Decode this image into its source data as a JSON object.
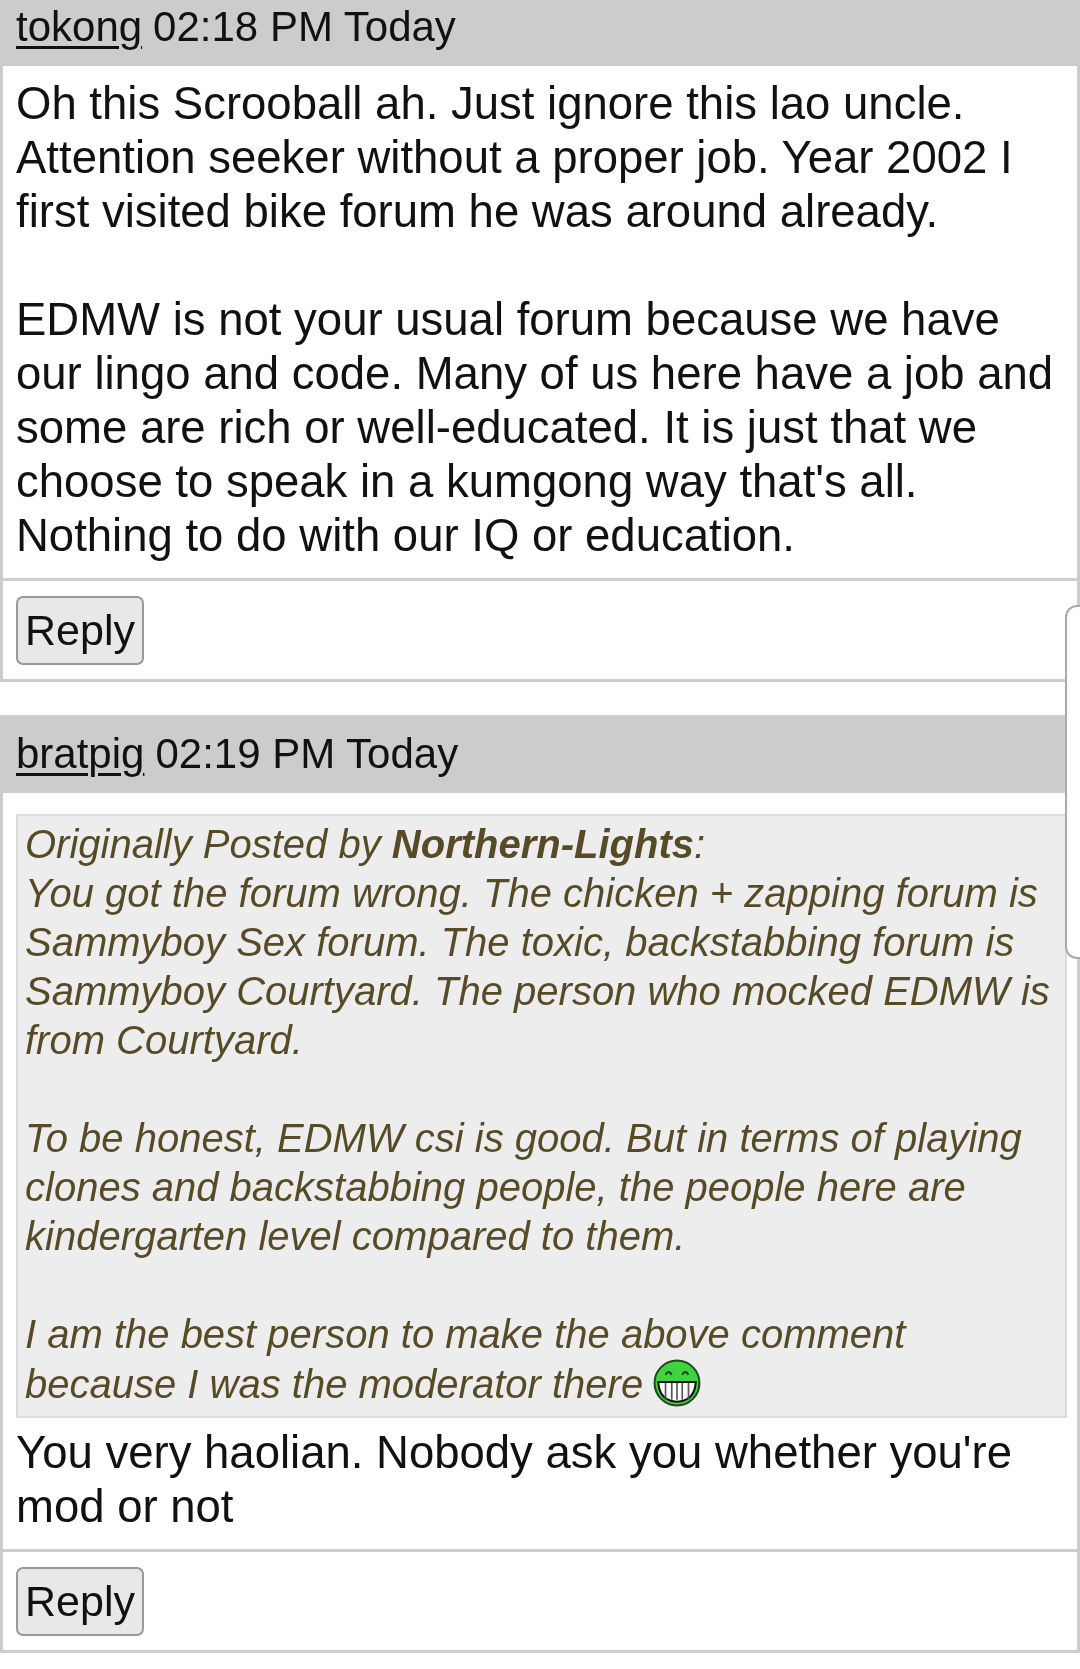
{
  "posts": [
    {
      "username": "tokong",
      "time": "02:18 PM Today",
      "paragraphs": [
        "Oh this Scrooball ah. Just ignore this lao uncle. Attention seeker without a proper job. Year 2002 I first visited bike forum he was around already.",
        "EDMW is not your usual forum because we have our lingo and code. Many of us here have a job and some are rich or well-educated. It is just that we choose to speak in a kumgong way that's all. Nothing to do with our IQ or education."
      ],
      "reply_button": "Reply"
    },
    {
      "username": "bratpig",
      "time": "02:19 PM Today",
      "quote": {
        "attribution": "Originally Posted by **Northern-Lights**:",
        "paragraphs": [
          {
            "text": "You got the forum wrong. The chicken + zapping forum is Sammyboy Sex forum. The toxic, backstabbing forum is Sammyboy Courtyard. The person who mocked EDMW is from Courtyard.",
            "smiley": false
          },
          {
            "text": "To be honest, EDMW csi is good. But in terms of playing clones and backstabbing people, the people here are kindergarten level compared to them.",
            "smiley": false
          },
          {
            "text": "I am the best person to make the above comment because I was the moderator there",
            "smiley": true
          }
        ]
      },
      "paragraphs": [
        "You very haolian. Nobody ask you whether you're mod or not"
      ],
      "reply_button": "Reply"
    }
  ]
}
